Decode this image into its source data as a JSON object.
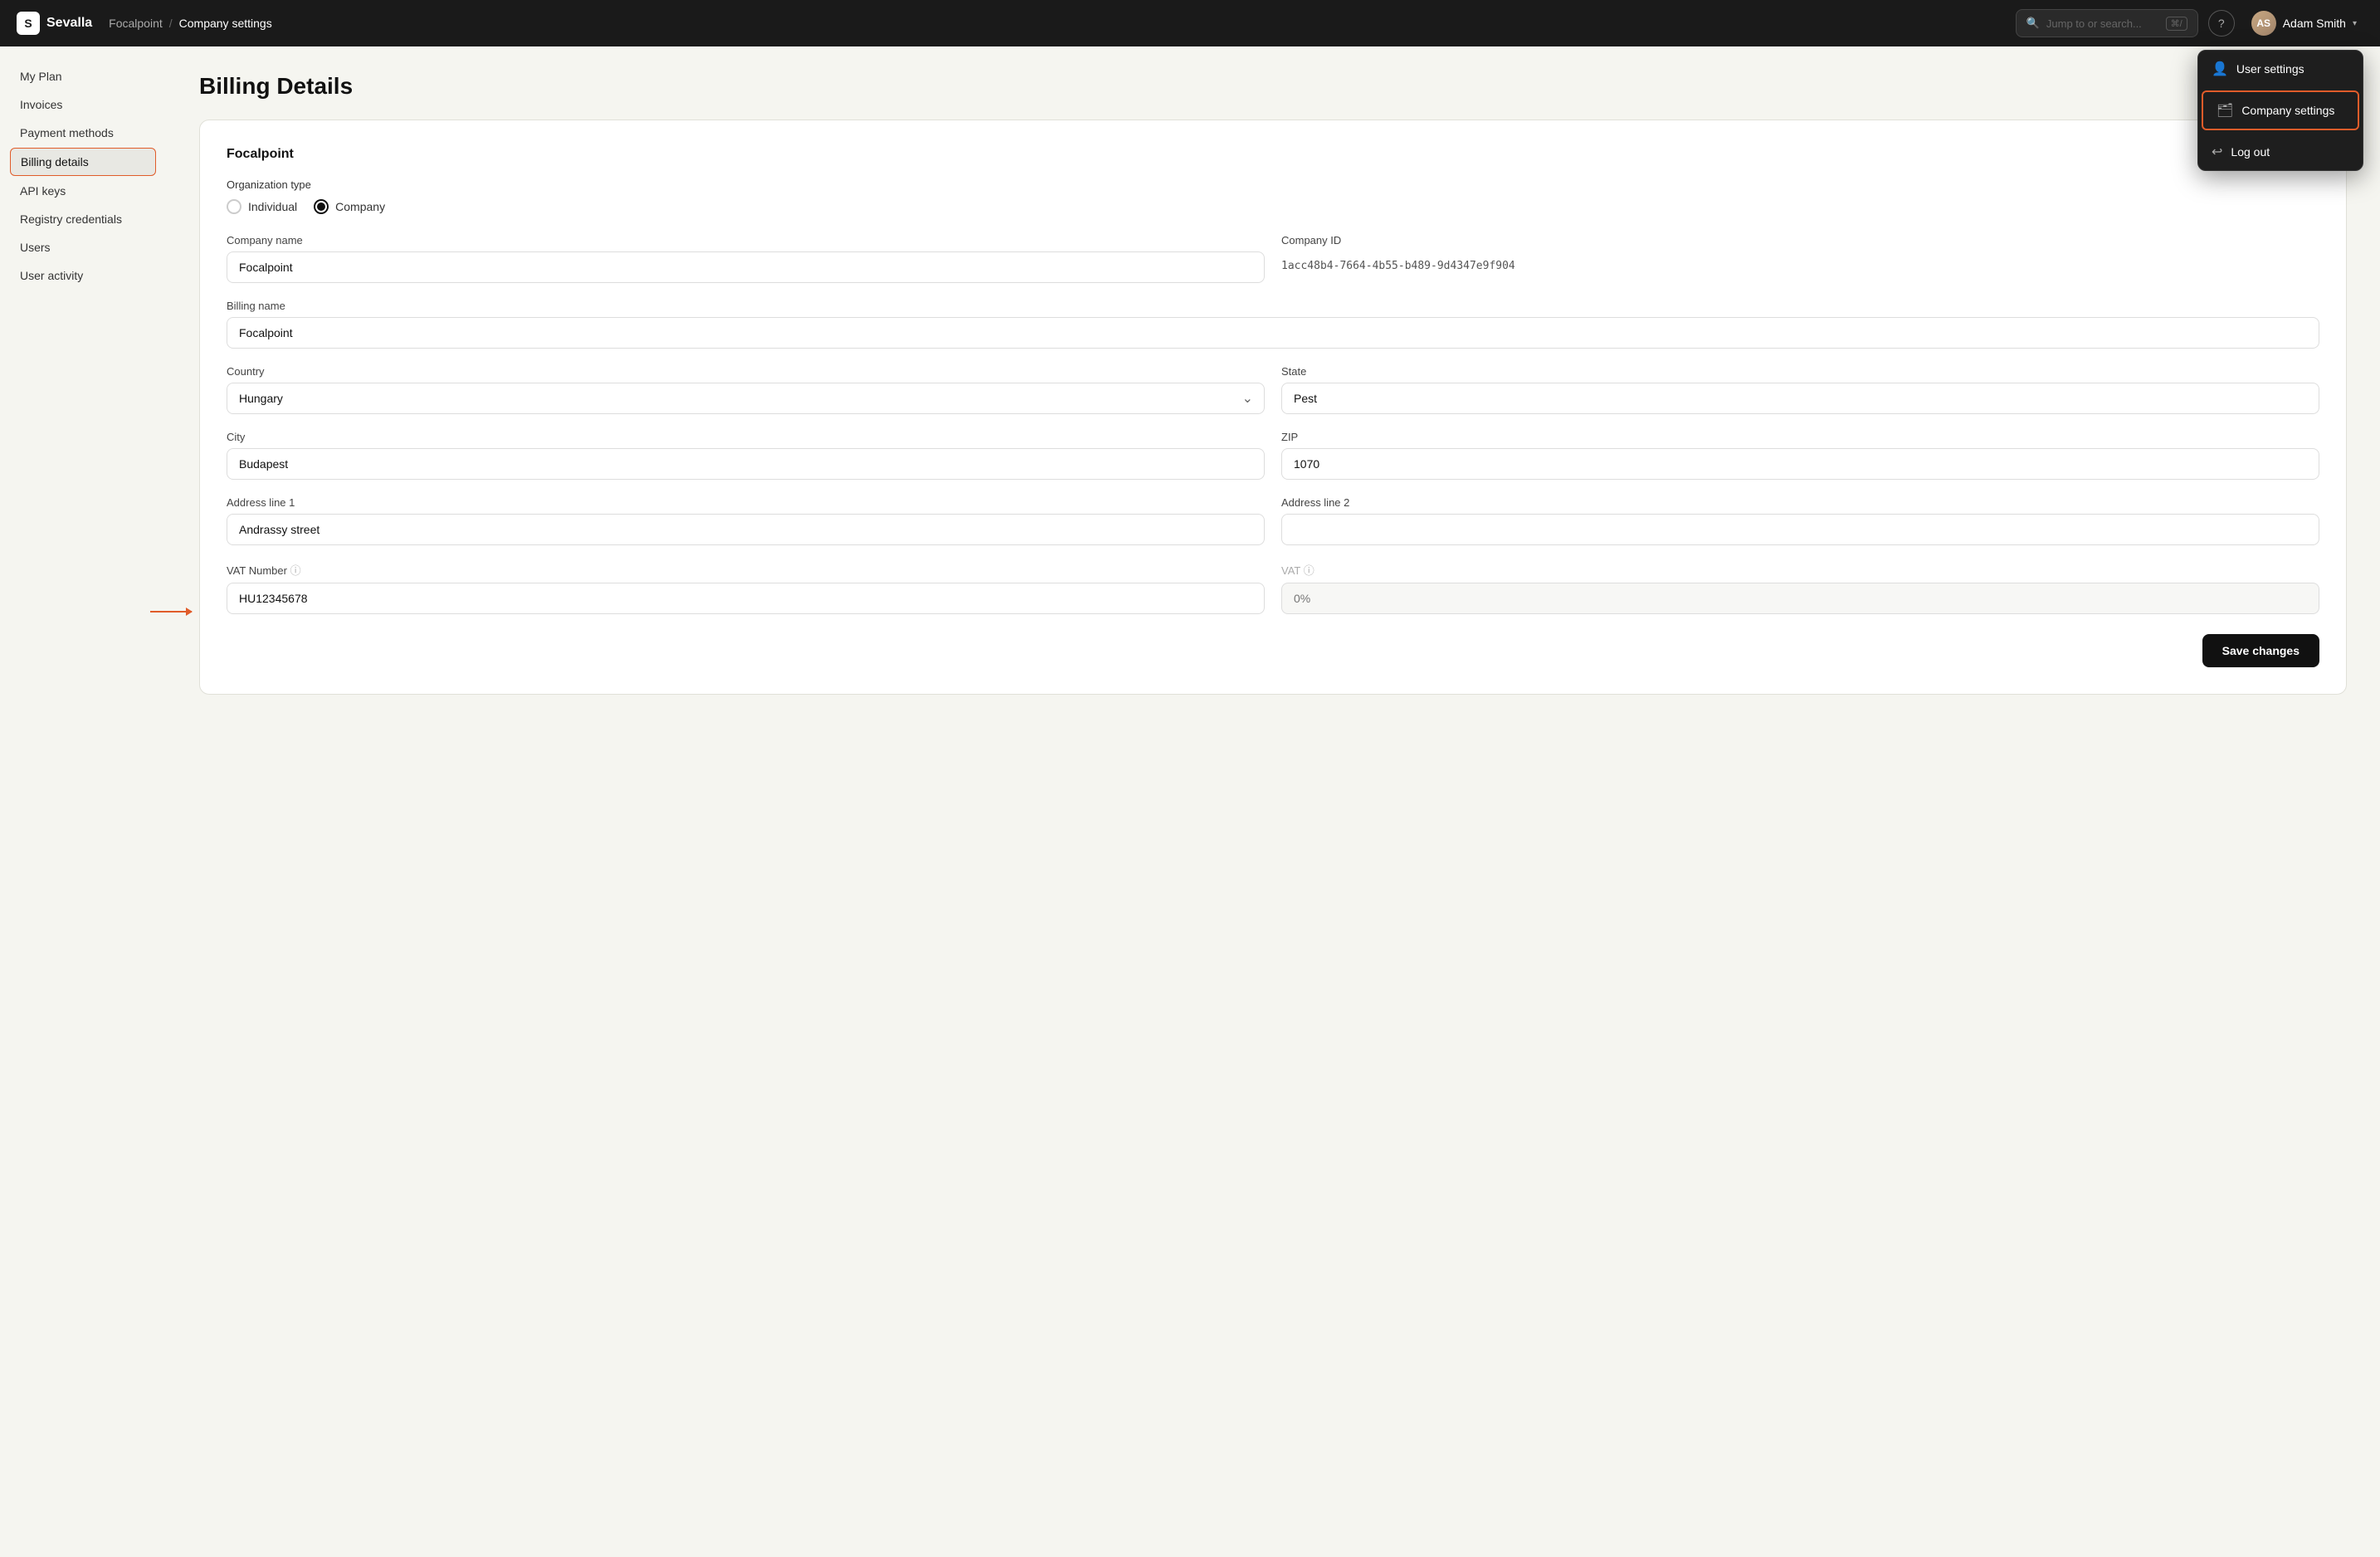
{
  "app": {
    "logo_text": "S",
    "brand_name": "Sevalla"
  },
  "breadcrumb": {
    "parent": "Focalpoint",
    "separator": "/",
    "current": "Company settings"
  },
  "search": {
    "placeholder": "Jump to or search...",
    "shortcut": "⌘/"
  },
  "user": {
    "name": "Adam Smith",
    "avatar_initials": "AS"
  },
  "dropdown_menu": {
    "items": [
      {
        "id": "user-settings",
        "label": "User settings",
        "icon": "👤"
      },
      {
        "id": "company-settings",
        "label": "Company settings",
        "icon": "🗂",
        "active": true
      },
      {
        "id": "log-out",
        "label": "Log out",
        "icon": "⎋"
      }
    ]
  },
  "sidebar": {
    "items": [
      {
        "id": "my-plan",
        "label": "My Plan"
      },
      {
        "id": "invoices",
        "label": "Invoices"
      },
      {
        "id": "payment-methods",
        "label": "Payment methods"
      },
      {
        "id": "billing-details",
        "label": "Billing details",
        "active": true
      },
      {
        "id": "api-keys",
        "label": "API keys"
      },
      {
        "id": "registry-credentials",
        "label": "Registry credentials"
      },
      {
        "id": "users",
        "label": "Users"
      },
      {
        "id": "user-activity",
        "label": "User activity"
      }
    ]
  },
  "page": {
    "title": "Billing Details"
  },
  "form": {
    "company_name_display": "Focalpoint",
    "org_type_label": "Organization type",
    "org_types": [
      {
        "id": "individual",
        "label": "Individual",
        "checked": false
      },
      {
        "id": "company",
        "label": "Company",
        "checked": true
      }
    ],
    "company_name_label": "Company name",
    "company_name_value": "Focalpoint",
    "company_id_label": "Company ID",
    "company_id_value": "1acc48b4-7664-4b55-b489-9d4347e9f904",
    "billing_name_label": "Billing name",
    "billing_name_value": "Focalpoint",
    "country_label": "Country",
    "country_value": "Hungary",
    "state_label": "State",
    "state_value": "Pest",
    "city_label": "City",
    "city_value": "Budapest",
    "zip_label": "ZIP",
    "zip_value": "1070",
    "address1_label": "Address line 1",
    "address1_value": "Andrassy street",
    "address2_label": "Address line 2",
    "address2_value": "",
    "vat_number_label": "VAT Number",
    "vat_number_value": "HU12345678",
    "vat_label": "VAT",
    "vat_value": "0%",
    "save_label": "Save changes"
  }
}
